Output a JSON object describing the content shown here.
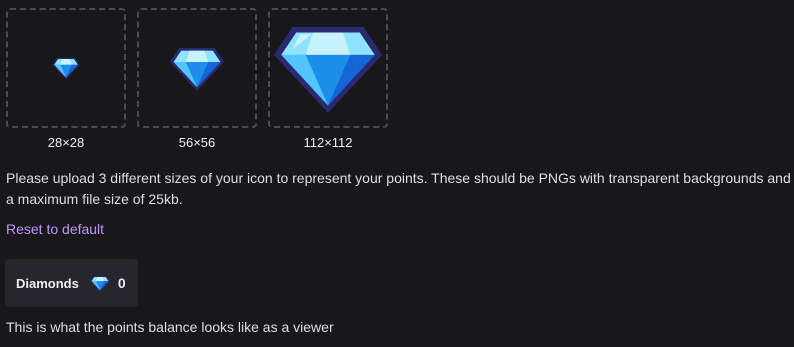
{
  "icons": [
    {
      "size_label": "28×28",
      "icon": "diamond-icon"
    },
    {
      "size_label": "56×56",
      "icon": "diamond-icon"
    },
    {
      "size_label": "112×112",
      "icon": "diamond-icon"
    }
  ],
  "help_text": "Please upload 3 different sizes of your icon to represent your points. These should be PNGs with transparent backgrounds and a maximum file size of 25kb.",
  "reset_label": "Reset to default",
  "balance_preview": {
    "name": "Diamonds",
    "icon": "diamond-icon",
    "value": "0"
  },
  "viewer_note": "This is what the points balance looks like as a viewer",
  "colors": {
    "background": "#18181b",
    "link": "#bf94ff",
    "card": "#26262c",
    "diamond_light": "#8fe3ff",
    "diamond_mid": "#2aa8f5",
    "diamond_dark": "#1565d8"
  }
}
